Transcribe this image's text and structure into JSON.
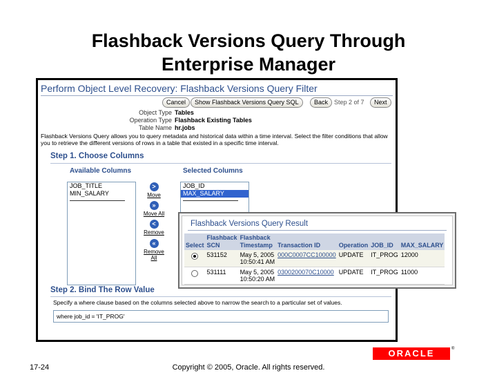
{
  "slide": {
    "title_line1": "Flashback Versions Query Through",
    "title_line2": "Enterprise Manager",
    "slide_number": "17-24",
    "copyright": "Copyright © 2005, Oracle. All rights reserved.",
    "logo_text": "ORACLE",
    "logo_mark": "®"
  },
  "em_page": {
    "heading": "Perform Object Level Recovery: Flashback Versions Query Filter",
    "buttons": {
      "cancel": "Cancel",
      "show_query": "Show Flashback Versions Query SQL",
      "back": "Back",
      "next": "Next"
    },
    "step_indicator": "Step 2 of 7",
    "info": [
      {
        "label": "Object Type",
        "value": "Tables"
      },
      {
        "label": "Operation Type",
        "value": "Flashback Existing Tables"
      },
      {
        "label": "Table Name",
        "value": "hr.jobs"
      }
    ],
    "description": "Flashback Versions Query allows you to query metadata and historical data within a time interval. Select the filter conditions that allow you to retrieve the different versions of rows in a table that existed in a specific time interval.",
    "step1": {
      "title": "Step 1. Choose Columns",
      "available_title": "Available Columns",
      "selected_title": "Selected Columns",
      "available": [
        "JOB_TITLE",
        "MIN_SALARY"
      ],
      "selected": [
        "JOB_ID",
        "MAX_SALARY"
      ],
      "shuttle": {
        "move": "Move",
        "move_all": "Move All",
        "remove": "Remove",
        "remove_all_1": "Remove",
        "remove_all_2": "All"
      }
    },
    "step2": {
      "title": "Step 2. Bind The Row Value",
      "hint": "Specify a where clause based on the columns selected above to narrow the search to a particular set of values.",
      "where_value": "where job_id = 'IT_PROG'"
    }
  },
  "result": {
    "title": "Flashback Versions Query Result",
    "headers": {
      "select": [
        "",
        "Select"
      ],
      "scn": [
        "Flashback",
        "SCN"
      ],
      "timestamp": [
        "Flashback",
        "Timestamp"
      ],
      "transaction": [
        "",
        "Transaction ID"
      ],
      "operation": [
        "",
        "Operation"
      ],
      "job_id": [
        "",
        "JOB_ID"
      ],
      "max_salary": [
        "",
        "MAX_SALARY"
      ]
    },
    "rows": [
      {
        "selected": true,
        "scn": "531152",
        "ts1": "May 5, 2005",
        "ts2": "10:50:41 AM",
        "txn": "000C0007CC100000",
        "op": "UPDATE",
        "job": "IT_PROG",
        "sal": "12000"
      },
      {
        "selected": false,
        "scn": "531111",
        "ts1": "May 5, 2005",
        "ts2": "10:50:20 AM",
        "txn": "0300200070C10000",
        "op": "UPDATE",
        "job": "IT_PROG",
        "sal": "11000"
      }
    ]
  }
}
